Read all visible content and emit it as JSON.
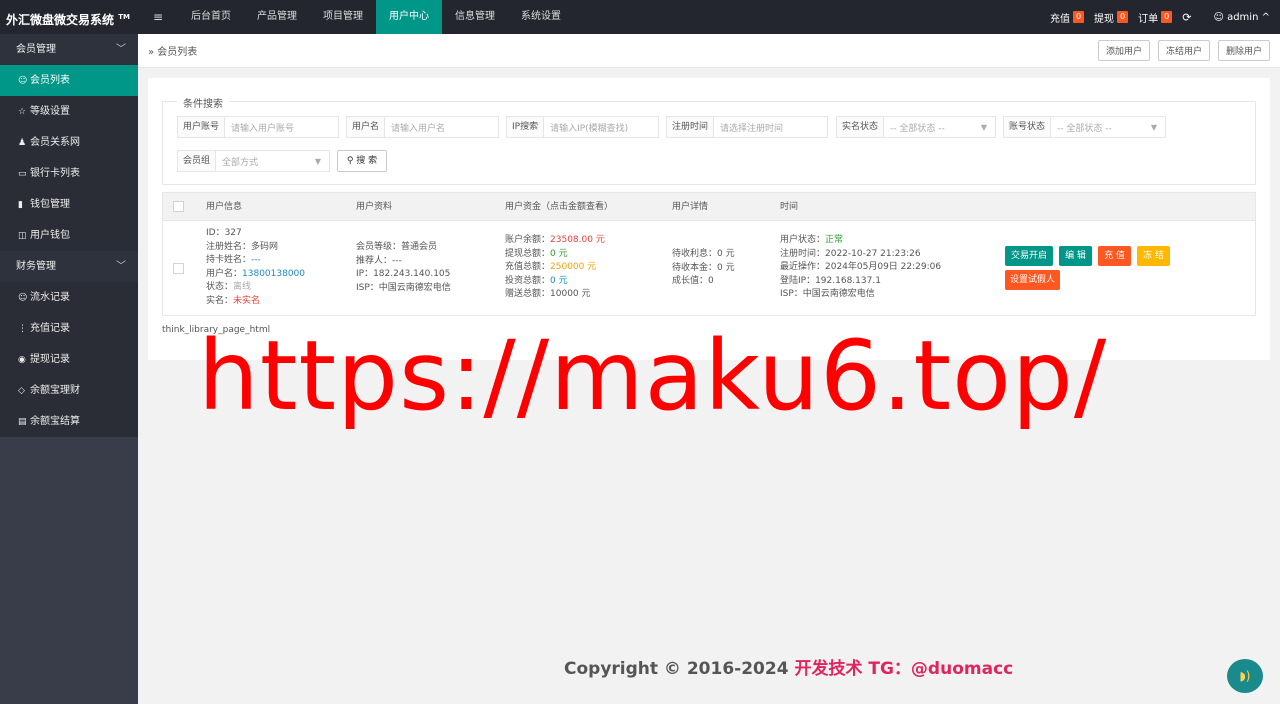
{
  "header": {
    "brand": "外汇微盘微交易系统",
    "brand_sup": "TM",
    "menu_icon": "≡",
    "nav": [
      "后台首页",
      "产品管理",
      "项目管理",
      "用户中心",
      "信息管理",
      "系统设置"
    ],
    "active_nav": "用户中心",
    "recharge_label": "充值",
    "recharge_count": "0",
    "withdraw_label": "提现",
    "withdraw_count": "0",
    "order_label": "订单",
    "order_count": "0",
    "user": "admin"
  },
  "sidebar": {
    "group1": "会员管理",
    "items1": [
      "会员列表",
      "等级设置",
      "会员关系网",
      "银行卡列表",
      "钱包管理",
      "用户钱包"
    ],
    "group2": "财务管理",
    "items2": [
      "流水记录",
      "充值记录",
      "提现记录",
      "余额宝理财",
      "余额宝结算"
    ]
  },
  "tabbar": {
    "crumb": "会员列表",
    "buttons": [
      "添加用户",
      "冻结用户",
      "删除用户"
    ]
  },
  "search": {
    "legend": "条件搜索",
    "account_label": "用户账号",
    "account_ph": "请输入用户账号",
    "name_label": "用户名",
    "name_ph": "请输入用户名",
    "ip_label": "IP搜索",
    "ip_ph": "请输入IP(模糊查找)",
    "regtime_label": "注册时间",
    "regtime_ph": "请选择注册时间",
    "realname_label": "实名状态",
    "realname_val": "-- 全部状态 --",
    "accstatus_label": "账号状态",
    "accstatus_val": "-- 全部状态 --",
    "group_label": "会员组",
    "group_val": "全部方式",
    "search_btn": "搜 索"
  },
  "table": {
    "headers": [
      "用户信息",
      "用户资料",
      "用户资金（点击金额查看）",
      "用户详情",
      "时间"
    ],
    "row": {
      "info": {
        "id": "ID：327",
        "reg_name_label": "注册姓名：",
        "reg_name": "多码网",
        "card_name_label": "持卡姓名：",
        "card_name": "---",
        "username_label": "用户名：",
        "username": "13800138000",
        "status_label": "状态：",
        "status": "离线",
        "realname_label": "实名：",
        "realname": "未实名"
      },
      "profile": {
        "level": "会员等级：普通会员",
        "referrer": "推荐人：---",
        "ip": "IP：182.243.140.105",
        "isp": "ISP：中国云南德宏电信"
      },
      "funds": {
        "balance_label": "账户余额：",
        "balance": "23508.00 元",
        "withdraw_label": "提现总额：",
        "withdraw": "0 元",
        "recharge_label": "充值总额：",
        "recharge": "250000 元",
        "invest_label": "投资总额：",
        "invest": "0 元",
        "gift_label": "赠送总额：",
        "gift": "10000 元"
      },
      "details": {
        "pending_interest": "待收利息：0 元",
        "pending_principal": "待收本金：0 元",
        "growth": "成长值：0"
      },
      "time": {
        "status_label": "用户状态：",
        "status": "正常",
        "reg_time": "注册时间：2022-10-27 21:23:26",
        "last_op": "最近操作：2024年05月09日 22:29:06",
        "login_ip": "登陆IP：192.168.137.1",
        "isp": "ISP：中国云南德宏电信"
      },
      "actions": [
        "交易开启",
        "编 辑",
        "充 值",
        "冻 结",
        "设置试假人"
      ]
    },
    "pager": "think_library_page_html"
  },
  "watermark": "https://maku6.top/",
  "footer": {
    "copyright": "Copyright © 2016-2024 ",
    "dev": "开发技术 TG：@duomacc"
  },
  "colors": {
    "accent": "#009688",
    "topbar": "#23262e",
    "sidebar": "#393d49",
    "danger": "#ff5722",
    "warning": "#ffb800"
  }
}
